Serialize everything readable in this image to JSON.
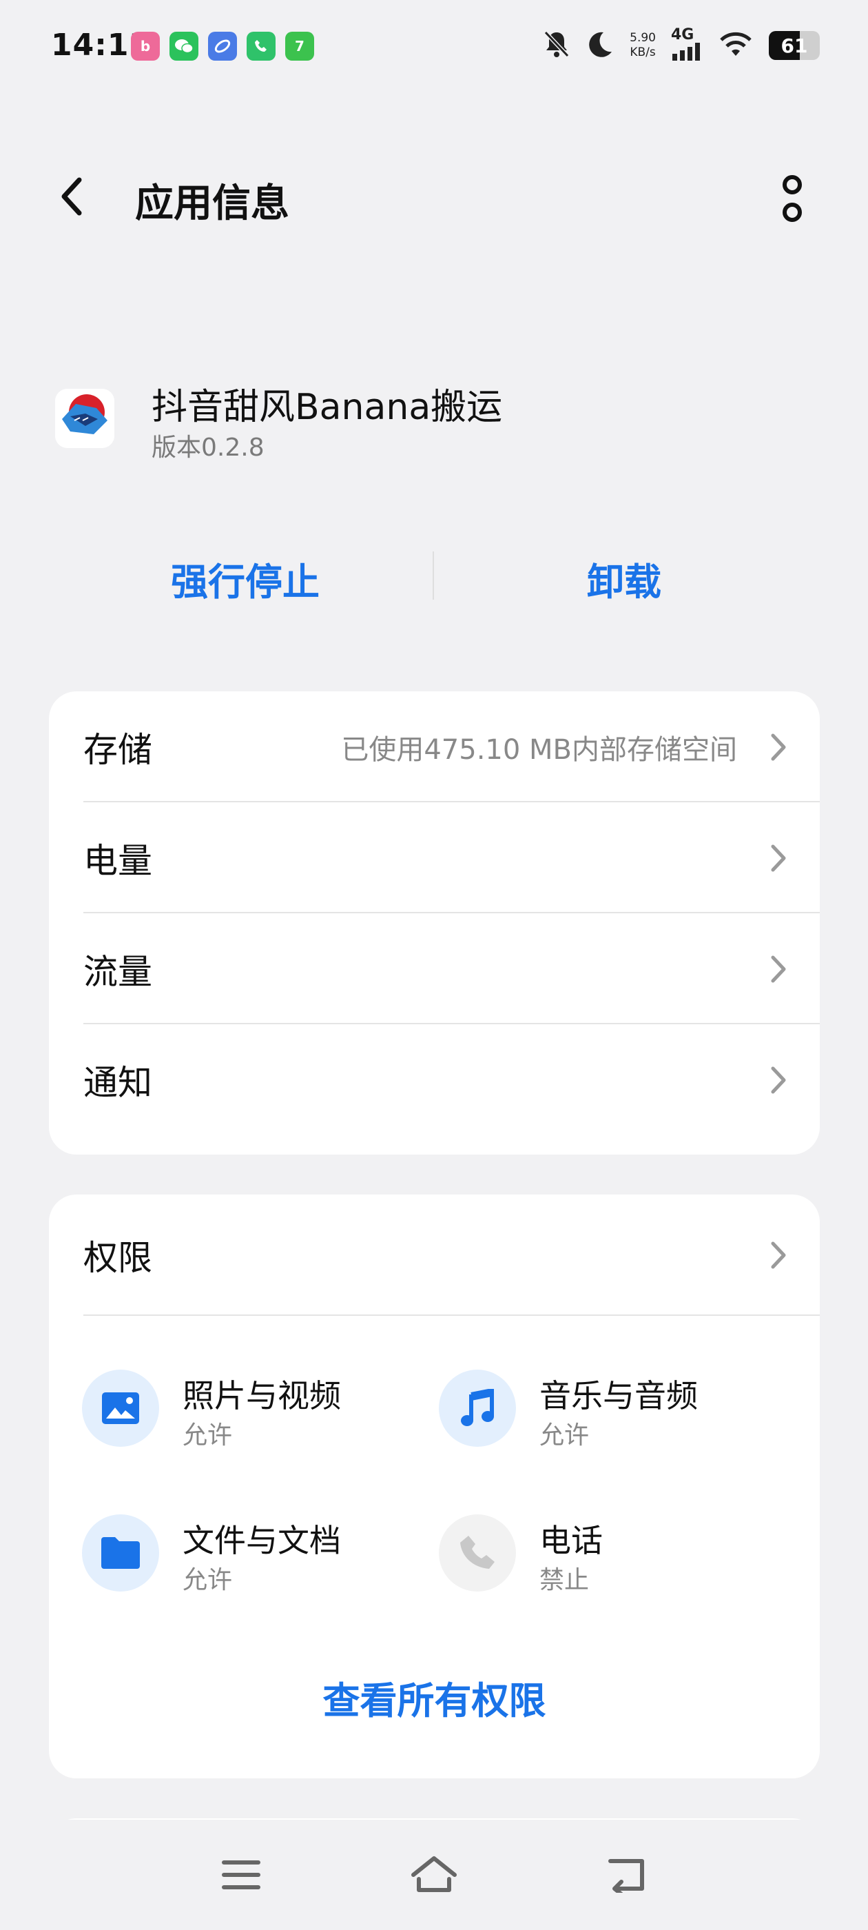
{
  "status_bar": {
    "time": "14:13",
    "net_speed_value": "5.90",
    "net_speed_unit": "KB/s",
    "network": "4G",
    "battery": "61",
    "battery_level": 0.61
  },
  "header": {
    "title": "应用信息"
  },
  "app": {
    "name": "抖音甜风Banana搬运",
    "version": "版本0.2.8"
  },
  "actions": {
    "force_stop": "强行停止",
    "uninstall": "卸载"
  },
  "settings": [
    {
      "label": "存储",
      "value": "已使用475.10 MB内部存储空间"
    },
    {
      "label": "电量",
      "value": ""
    },
    {
      "label": "流量",
      "value": ""
    },
    {
      "label": "通知",
      "value": ""
    }
  ],
  "permissions": {
    "title": "权限",
    "items": [
      {
        "name": "照片与视频",
        "status": "允许",
        "icon": "image-icon"
      },
      {
        "name": "音乐与音频",
        "status": "允许",
        "icon": "music-icon"
      },
      {
        "name": "文件与文档",
        "status": "允许",
        "icon": "folder-icon"
      },
      {
        "name": "电话",
        "status": "禁止",
        "icon": "phone-icon"
      }
    ],
    "view_all": "查看所有权限"
  },
  "colors": {
    "accent": "#1a73e8",
    "background": "#f1f1f3",
    "card": "#ffffff",
    "secondary_text": "#888888",
    "allowed_icon_bg": "#e3effd",
    "denied_icon_bg": "#f2f2f2"
  }
}
